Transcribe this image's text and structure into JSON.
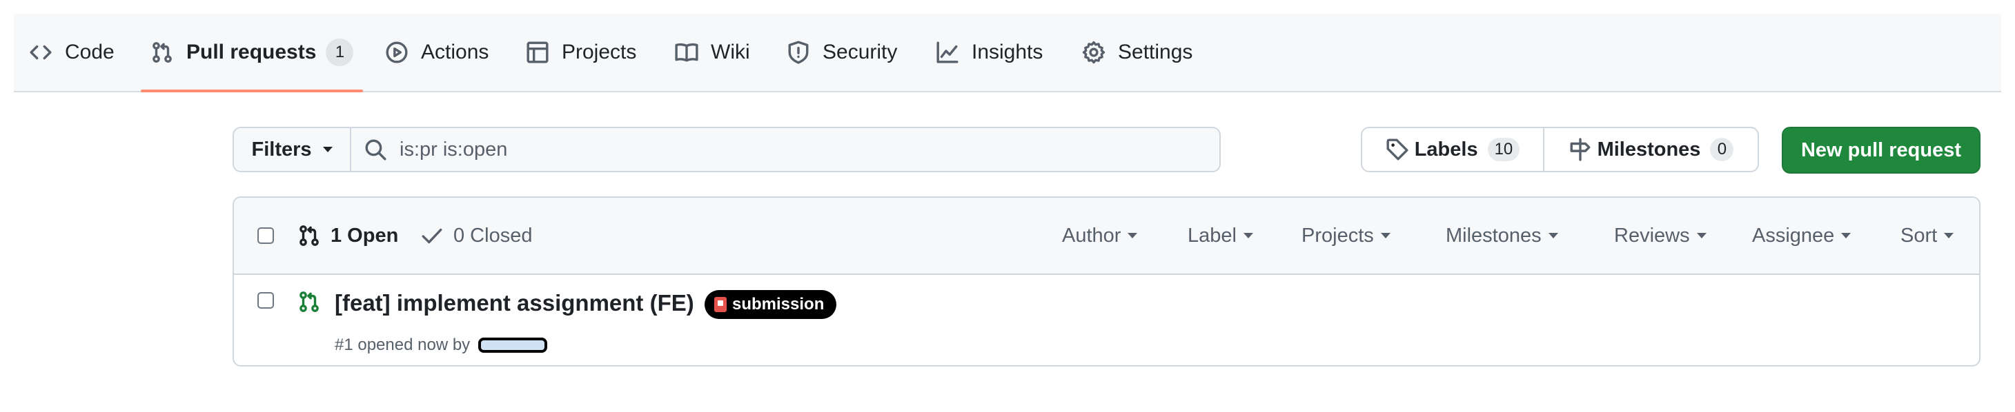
{
  "repo_nav": {
    "tabs": [
      {
        "label": "Code",
        "icon": "code-icon"
      },
      {
        "label": "Pull requests",
        "icon": "git-pull-request-icon",
        "count": "1",
        "selected": true
      },
      {
        "label": "Actions",
        "icon": "play-circle-icon"
      },
      {
        "label": "Projects",
        "icon": "table-icon"
      },
      {
        "label": "Wiki",
        "icon": "book-icon"
      },
      {
        "label": "Security",
        "icon": "shield-icon"
      },
      {
        "label": "Insights",
        "icon": "graph-icon"
      },
      {
        "label": "Settings",
        "icon": "gear-icon"
      }
    ],
    "selected_underline_color": "#fd8c73"
  },
  "toolbar": {
    "filters_label": "Filters",
    "search_value": "is:pr is:open",
    "labels_label": "Labels",
    "labels_count": "10",
    "milestones_label": "Milestones",
    "milestones_count": "0",
    "new_pr_label": "New pull request",
    "new_pr_color": "#1f883d"
  },
  "list_header": {
    "open_label": "1 Open",
    "closed_label": "0 Closed",
    "filters": [
      "Author",
      "Label",
      "Projects",
      "Milestones",
      "Reviews",
      "Assignee",
      "Sort"
    ]
  },
  "pull_requests": [
    {
      "title": "[feat] implement assignment (FE)",
      "label": "submission",
      "meta": "#1 opened now by",
      "author_redacted": true,
      "state_color": "#1a7f37"
    }
  ]
}
